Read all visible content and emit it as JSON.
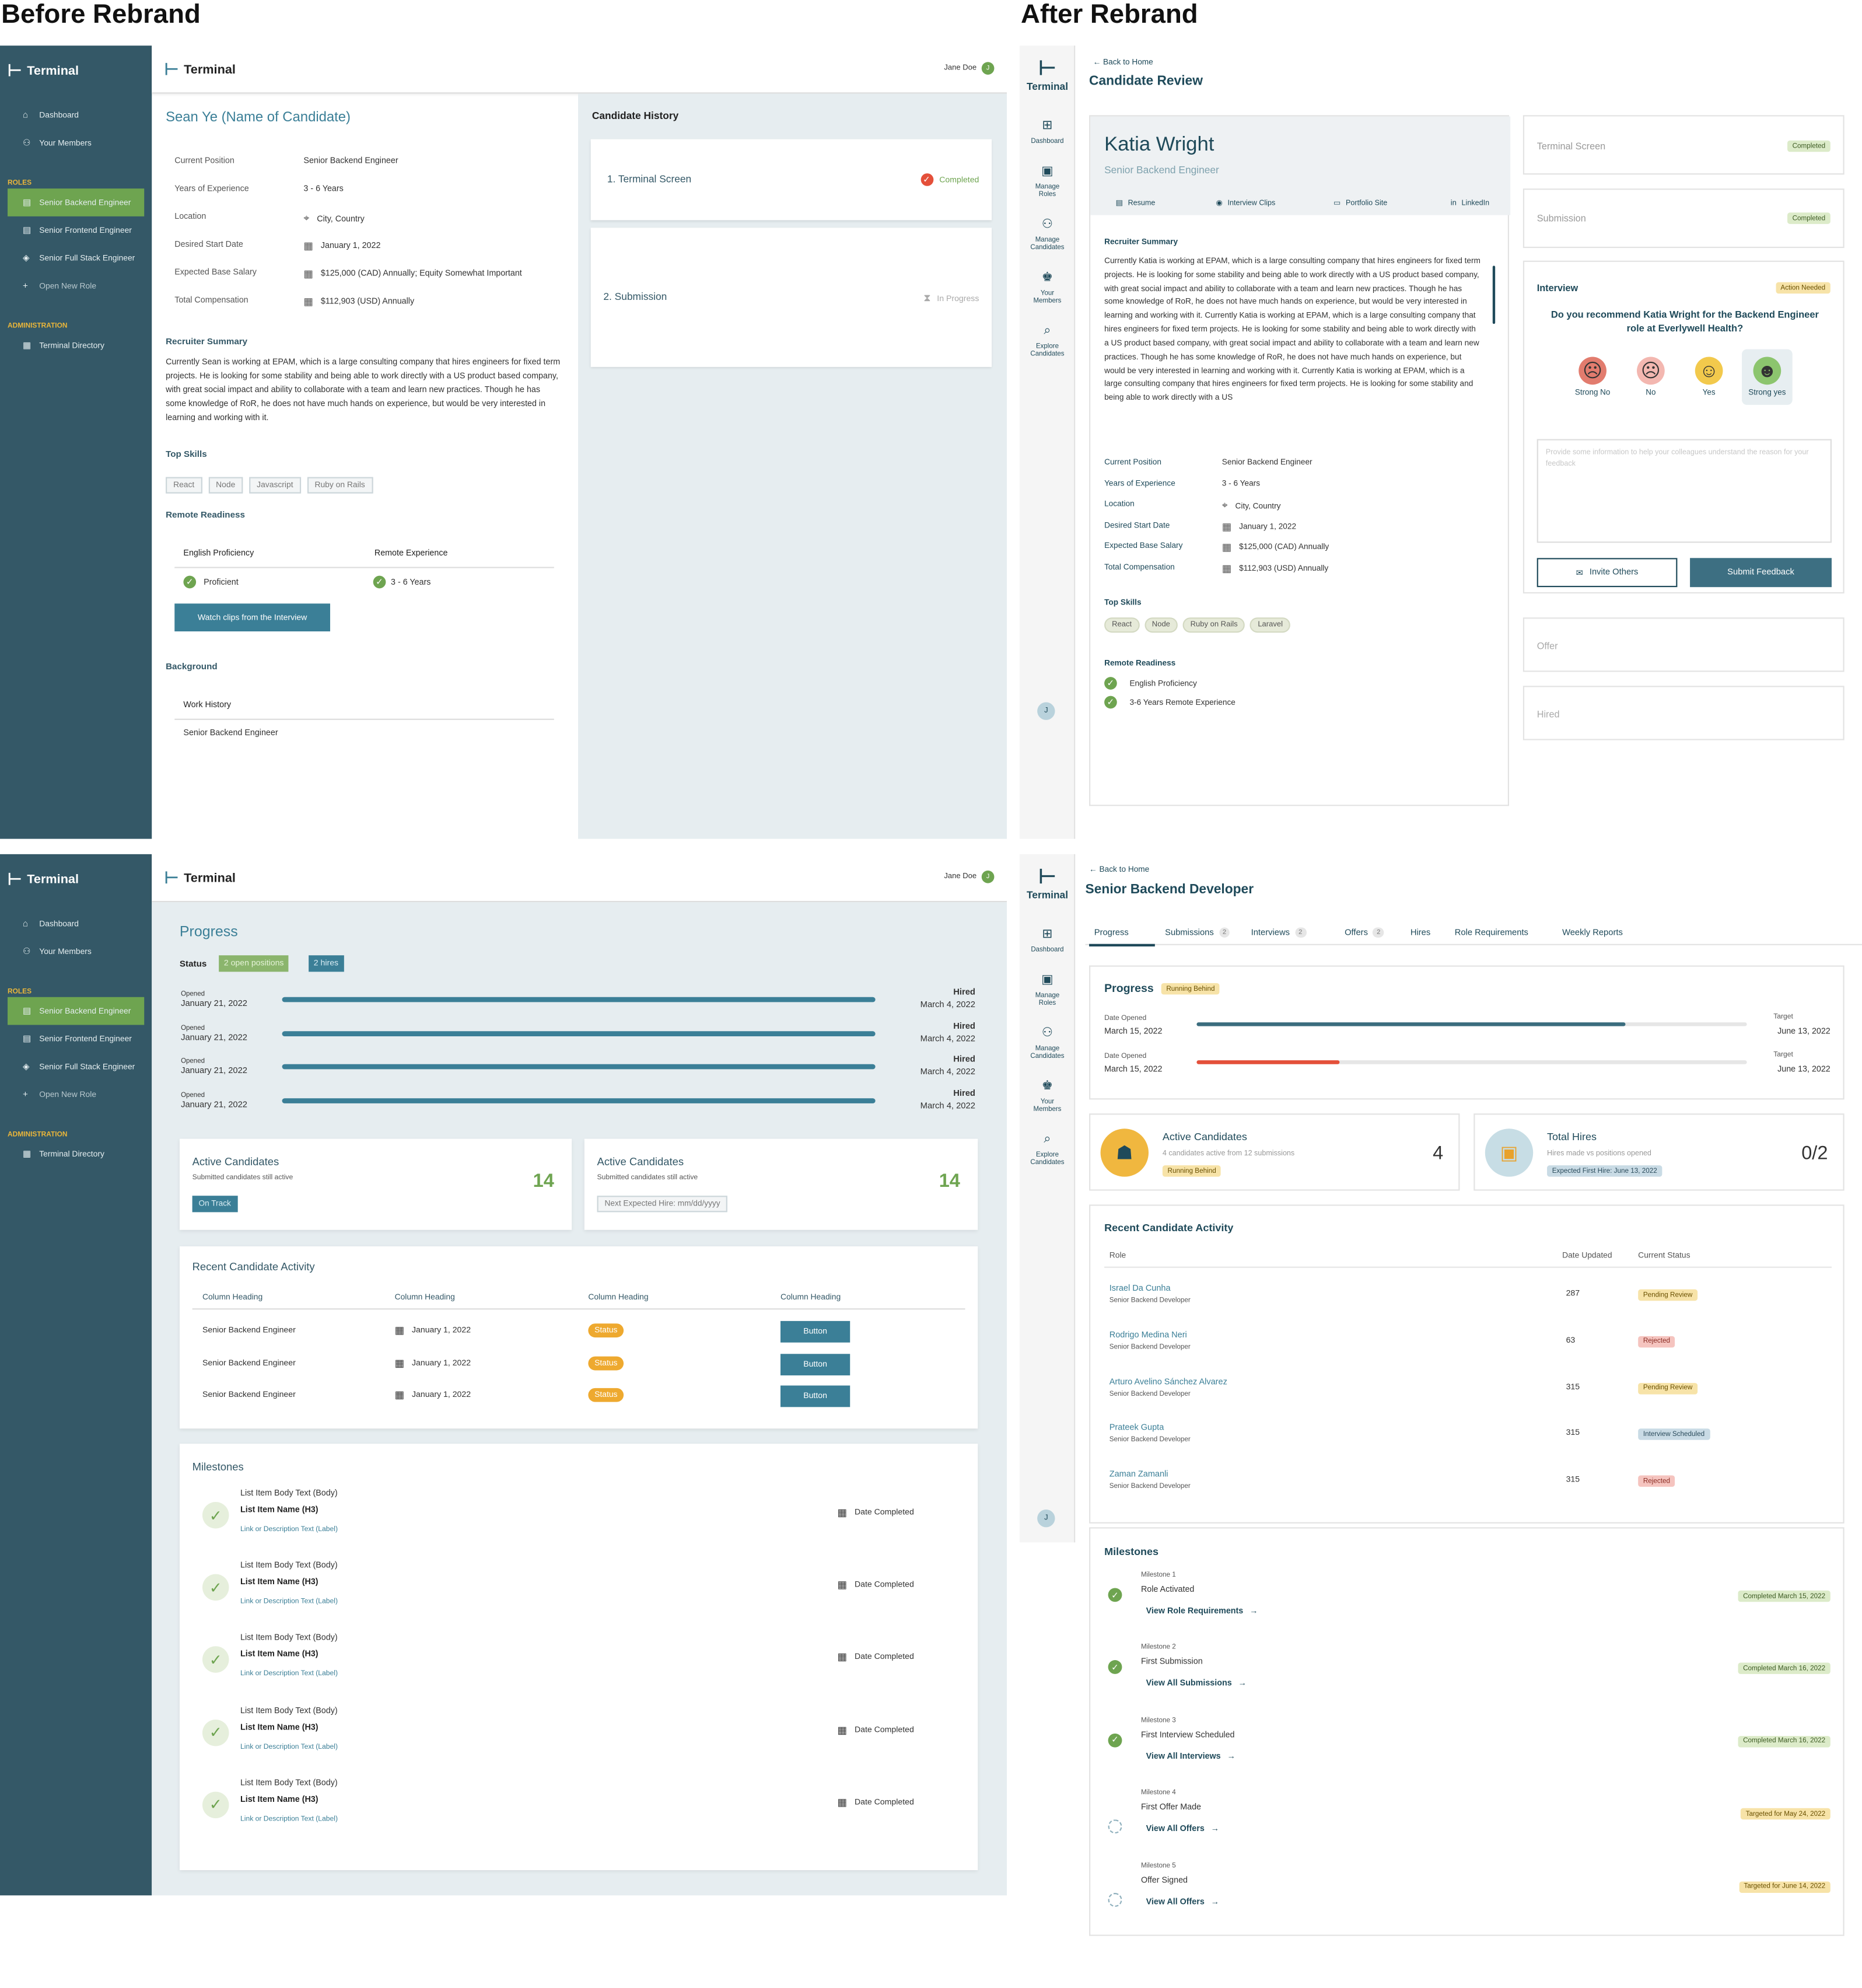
{
  "labels": {
    "before": "Before Rebrand",
    "after": "After Rebrand"
  },
  "brand": {
    "name": "Terminal",
    "user": "Jane Doe",
    "user_initial": "J",
    "avatar_initial": "J",
    "old_accent": "#6ea450",
    "old_sidebar": "#345867",
    "new_teal": "#1f4a5a"
  },
  "old_nav": {
    "dashboard": "Dashboard",
    "members": "Your Members",
    "roles_header": "ROLES",
    "role1": "Senior Backend Engineer",
    "role2": "Senior Frontend Engineer",
    "role3": "Senior Full Stack Engineer",
    "open_new": "Open New Role",
    "admin_header": "ADMINISTRATION",
    "directory": "Terminal Directory"
  },
  "new_nav": {
    "logo": "Terminal",
    "dashboard": "Dashboard",
    "manage_roles_1": "Manage",
    "manage_roles_2": "Roles",
    "manage_cand_1": "Manage",
    "manage_cand_2": "Candidates",
    "members_1": "Your",
    "members_2": "Members",
    "explore_1": "Explore",
    "explore_2": "Candidates"
  },
  "p1": {
    "title": "Sean Ye (Name of Candidate)",
    "details": [
      {
        "label": "Current Position",
        "value": "Senior Backend Engineer"
      },
      {
        "label": "Years of Experience",
        "value": "3 - 6 Years"
      },
      {
        "label": "Location",
        "value": "City, Country"
      },
      {
        "label": "Desired Start Date",
        "value": "January 1, 2022"
      },
      {
        "label": "Expected Base Salary",
        "value": "$125,000 (CAD) Annually; Equity Somewhat Important"
      },
      {
        "label": "Total Compensation",
        "value": "$112,903 (USD) Annually"
      }
    ],
    "summary_title": "Recruiter Summary",
    "summary": "Currently Sean is working at EPAM, which is a large consulting company that hires engineers for fixed term projects. He is looking for some stability and being able to work directly with a US product based company, with great social impact and ability to collaborate with a team and learn new practices. Though he has some knowledge of RoR, he does not have much hands on experience, but would be very interested in learning and working with it.",
    "skills_title": "Top Skills",
    "skills": [
      "React",
      "Node",
      "Javascript",
      "Ruby on Rails"
    ],
    "remote_title": "Remote Readiness",
    "english_h": "English Proficiency",
    "remote_h": "Remote Experience",
    "english_v": "Proficient",
    "remote_v": "3 - 6 Years",
    "clips_btn": "Watch clips from the Interview",
    "background_title": "Background",
    "work_h": "Work History",
    "work_v": "Senior Backend Engineer",
    "history_title": "Candidate History",
    "hist1": "1. Terminal Screen",
    "hist1_status": "Completed",
    "hist2": "2. Submission",
    "hist2_status": "In Progress"
  },
  "p2": {
    "back": "Back to Home",
    "title": "Candidate Review",
    "name": "Katia Wright",
    "role": "Senior Backend Engineer",
    "links": [
      "Resume",
      "Interview Clips",
      "Portfolio Site",
      "LinkedIn"
    ],
    "summary_title": "Recruiter Summary",
    "summary": "Currently Katia is working at EPAM, which is a large consulting company that hires engineers for fixed term projects. He is looking for some stability and being able to work directly with a US product based company, with great social impact and ability to collaborate with a team and learn new practices. Though he has some knowledge of RoR, he does not have much hands on experience, but would be very interested in learning and working with it. Currently Katia is working at EPAM, which is a large consulting company that hires engineers for fixed term projects. He is looking for some stability and being able to work directly with a US product based company, with great social impact and ability to collaborate with a team and learn new practices. Though he has some knowledge of RoR, he does not have much hands on experience, but would be very interested in learning and working with it. Currently Katia is working at EPAM, which is a large consulting company that hires engineers for fixed term projects. He is looking for some stability and being able to work directly with a US",
    "details": [
      {
        "label": "Current Position",
        "value": "Senior Backend Engineer"
      },
      {
        "label": "Years of Experience",
        "value": "3 - 6 Years"
      },
      {
        "label": "Location",
        "value": "City, Country"
      },
      {
        "label": "Desired Start Date",
        "value": "January 1, 2022"
      },
      {
        "label": "Expected Base Salary",
        "value": "$125,000 (CAD) Annually"
      },
      {
        "label": "Total Compensation",
        "value": "$112,903 (USD) Annually"
      }
    ],
    "skills_title": "Top Skills",
    "skills": [
      "React",
      "Node",
      "Ruby on Rails",
      "Laravel"
    ],
    "remote_title": "Remote Readiness",
    "remote_items": [
      "English Proficiency",
      "3-6 Years Remote Experience"
    ],
    "stage1": "Terminal Screen",
    "stage1_status": "Completed",
    "stage2": "Submission",
    "stage2_status": "Completed",
    "interview": "Interview",
    "interview_status": "Action Needed",
    "question": "Do you recommend Katia Wright for the Backend Engineer role at Everlywell Health?",
    "options": [
      "Strong No",
      "No",
      "Yes",
      "Strong yes"
    ],
    "feedback_placeholder": "Provide some information to help your colleagues understand the reason for your feedback",
    "invite": "Invite Others",
    "submit": "Submit Feedback",
    "stage4": "Offer",
    "stage5": "Hired"
  },
  "p3": {
    "title": "Progress",
    "status_label": "Status",
    "open_pos": "2 open positions",
    "hires": "2 hires",
    "rows": [
      {
        "opened_label": "Opened",
        "opened": "January 21, 2022",
        "hired_label": "Hired",
        "hired": "March 4, 2022",
        "progress": 1.0
      },
      {
        "opened_label": "Opened",
        "opened": "January 21, 2022",
        "hired_label": "Hired",
        "hired": "March 4, 2022",
        "progress": 1.0
      },
      {
        "opened_label": "Opened",
        "opened": "January 21, 2022",
        "hired_label": "Hired",
        "hired": "March 4, 2022",
        "progress": 1.0
      },
      {
        "opened_label": "Opened",
        "opened": "January 21, 2022",
        "hired_label": "Hired",
        "hired": "March 4, 2022",
        "progress": 1.0
      }
    ],
    "card1": {
      "title": "Active Candidates",
      "sub": "Submitted candidates still active",
      "num": "14",
      "tag": "On Track"
    },
    "card2": {
      "title": "Active Candidates",
      "sub": "Submitted candidates still active",
      "num": "14",
      "tag": "Next Expected Hire: mm/dd/yyyy"
    },
    "activity_title": "Recent Candidate Activity",
    "col": "Column Heading",
    "act_rows": [
      {
        "role": "Senior Backend Engineer",
        "date": "January 1, 2022",
        "status": "Status",
        "btn": "Button"
      },
      {
        "role": "Senior Backend Engineer",
        "date": "January 1, 2022",
        "status": "Status",
        "btn": "Button"
      },
      {
        "role": "Senior Backend Engineer",
        "date": "January 1, 2022",
        "status": "Status",
        "btn": "Button"
      }
    ],
    "milestones_title": "Milestones",
    "ms": {
      "body": "List Item Body Text (Body)",
      "name": "List Item Name (H3)",
      "link": "Link or Description Text (Label)",
      "date": "Date Completed"
    }
  },
  "p4": {
    "back": "Back to Home",
    "title": "Senior Backend Developer",
    "tabs": [
      {
        "label": "Progress",
        "count": ""
      },
      {
        "label": "Submissions",
        "count": "2"
      },
      {
        "label": "Interviews",
        "count": "2"
      },
      {
        "label": "Offers",
        "count": "2"
      },
      {
        "label": "Hires",
        "count": ""
      },
      {
        "label": "Role Requirements",
        "count": ""
      },
      {
        "label": "Weekly Reports",
        "count": ""
      }
    ],
    "progress_title": "Progress",
    "progress_tag": "Running Behind",
    "prog_rows": [
      {
        "opened_label": "Date Opened",
        "opened": "March 15, 2022",
        "target_label": "Target",
        "target": "June 13, 2022",
        "progress": 0.78,
        "color": "#3b6d7e"
      },
      {
        "opened_label": "Date Opened",
        "opened": "March 15, 2022",
        "target_label": "Target",
        "target": "June 13, 2022",
        "progress": 0.26,
        "color": "#e4503a"
      }
    ],
    "active": {
      "title": "Active Candidates",
      "sub": "4 candidates active from 12 submissions",
      "tag": "Running Behind",
      "num": "4"
    },
    "hires": {
      "title": "Total Hires",
      "sub": "Hires made vs positions opened",
      "tag": "Expected First Hire: June 13, 2022",
      "num": "0/2"
    },
    "activity_title": "Recent Candidate Activity",
    "cols": [
      "Role",
      "Date Updated",
      "Current Status"
    ],
    "act_rows": [
      {
        "name": "Israel Da Cunha",
        "role": "Senior Backend Developer",
        "date": "287",
        "status": "Pending Review",
        "kind": "yel"
      },
      {
        "name": "Rodrigo Medina Neri",
        "role": "Senior Backend Developer",
        "date": "63",
        "status": "Rejected",
        "kind": "red"
      },
      {
        "name": "Arturo Avelino Sánchez Alvarez",
        "role": "Senior Backend Developer",
        "date": "315",
        "status": "Pending Review",
        "kind": "yel"
      },
      {
        "name": "Prateek Gupta",
        "role": "Senior Backend Developer",
        "date": "315",
        "status": "Interview Scheduled",
        "kind": "blu"
      },
      {
        "name": "Zaman Zamanli",
        "role": "Senior Backend Developer",
        "date": "315",
        "status": "Rejected",
        "kind": "red"
      }
    ],
    "milestones_title": "Milestones",
    "milestones": [
      {
        "num": "Milestone 1",
        "name": "Role Activated",
        "link": "View Role Requirements",
        "tag": "Completed March 15, 2022",
        "done": true
      },
      {
        "num": "Milestone 2",
        "name": "First Submission",
        "link": "View All Submissions",
        "tag": "Completed March 16, 2022",
        "done": true
      },
      {
        "num": "Milestone 3",
        "name": "First Interview Scheduled",
        "link": "View All Interviews",
        "tag": "Completed March 16, 2022",
        "done": true
      },
      {
        "num": "Milestone 4",
        "name": "First Offer Made",
        "link": "View All Offers",
        "tag": "Targeted for May 24, 2022",
        "done": false
      },
      {
        "num": "Milestone 5",
        "name": "Offer Signed",
        "link": "View All Offers",
        "tag": "Targeted for June 14, 2022",
        "done": false
      }
    ]
  },
  "icons": {
    "logo": "terminal-logo-icon",
    "home": "home-icon",
    "user": "user-icon",
    "list": "list-icon",
    "plus": "plus-icon",
    "dir": "directory-icon",
    "cal": "calendar-icon",
    "pin": "location-pin-icon",
    "check": "check-icon",
    "hourglass": "hourglass-icon"
  }
}
